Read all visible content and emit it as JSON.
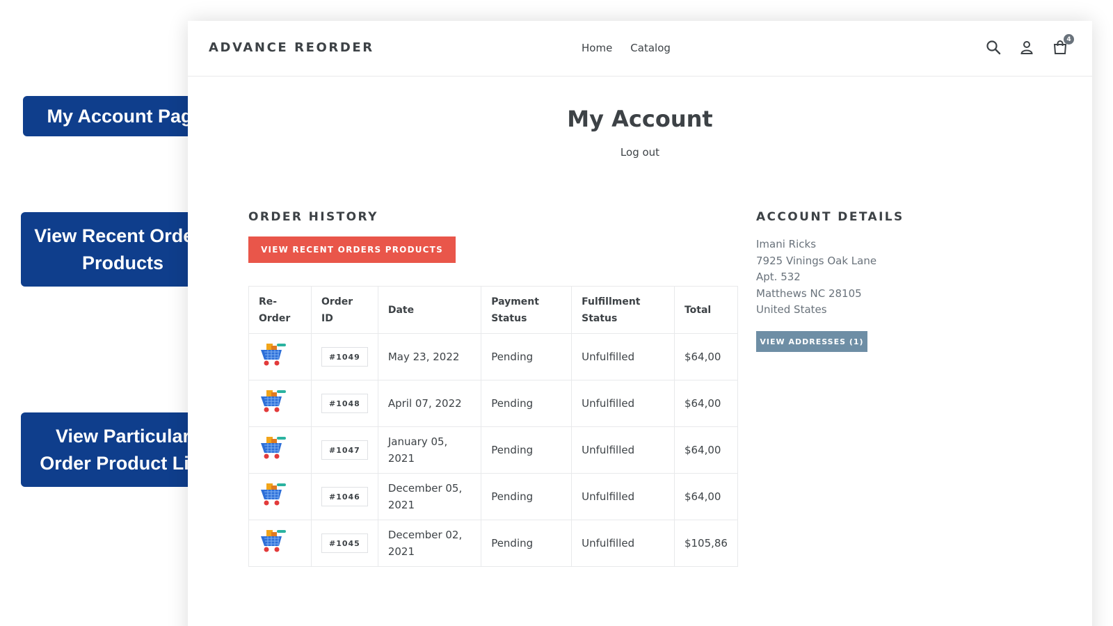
{
  "header": {
    "logo": "ADVANCE REORDER",
    "nav": [
      "Home",
      "Catalog"
    ],
    "cart_count": "4"
  },
  "page": {
    "title": "My Account",
    "logout": "Log out"
  },
  "order_history": {
    "heading": "ORDER HISTORY",
    "button": "VIEW RECENT ORDERS PRODUCTS",
    "columns": [
      "Re-Order",
      "Order ID",
      "Date",
      "Payment Status",
      "Fulfillment Status",
      "Total"
    ],
    "rows": [
      {
        "id": "#1049",
        "date": "May 23, 2022",
        "payment": "Pending",
        "fulfillment": "Unfulfilled",
        "total": "$64,00"
      },
      {
        "id": "#1048",
        "date": "April 07, 2022",
        "payment": "Pending",
        "fulfillment": "Unfulfilled",
        "total": "$64,00"
      },
      {
        "id": "#1047",
        "date": "January 05, 2021",
        "payment": "Pending",
        "fulfillment": "Unfulfilled",
        "total": "$64,00"
      },
      {
        "id": "#1046",
        "date": "December 05, 2021",
        "payment": "Pending",
        "fulfillment": "Unfulfilled",
        "total": "$64,00"
      },
      {
        "id": "#1045",
        "date": "December 02, 2021",
        "payment": "Pending",
        "fulfillment": "Unfulfilled",
        "total": "$105,86"
      }
    ]
  },
  "account_details": {
    "heading": "ACCOUNT DETAILS",
    "name": "Imani Ricks",
    "address1": "7925 Vinings Oak Lane",
    "address2": "Apt. 532",
    "city_line": "Matthews NC 28105",
    "country": "United States",
    "button": "VIEW ADDRESSES (1)"
  },
  "callouts": {
    "account_page": "My Account Page",
    "recent_orders": "View Recent Orders Products",
    "particular_order": "View Particular Order Product List"
  },
  "colors": {
    "primary_button": "#e9564a",
    "secondary_button": "#6e8ea5",
    "callout": "#0f3e8c"
  },
  "icons": [
    "search-icon",
    "user-icon",
    "shopping-bag-icon",
    "reorder-cart-icon"
  ]
}
